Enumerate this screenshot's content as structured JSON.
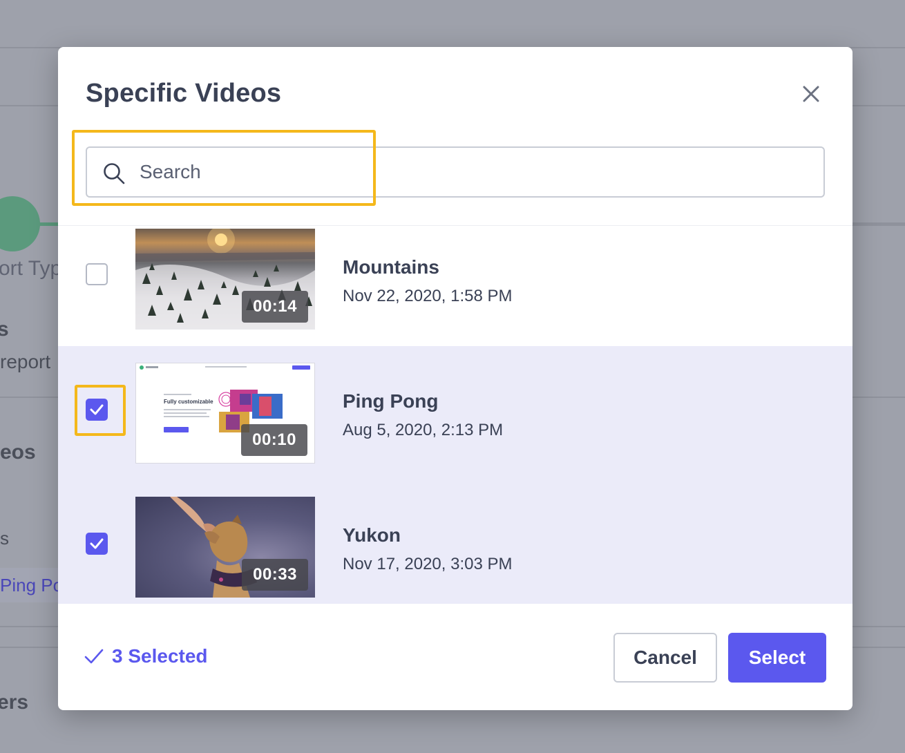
{
  "background": {
    "step_label": "ort Typ",
    "heading_s": "s",
    "report_text": "report",
    "videos_text": "eos",
    "s_text": "s",
    "chip_text": "Ping Po",
    "ers_text": "ers"
  },
  "modal": {
    "title": "Specific Videos",
    "close_icon": "close-icon"
  },
  "search": {
    "placeholder": "Search",
    "value": "",
    "icon": "search-icon"
  },
  "videos": [
    {
      "title": "Mountains",
      "date": "Nov 22, 2020, 1:58 PM",
      "duration": "00:14",
      "checked": false
    },
    {
      "title": "Ping Pong",
      "date": "Aug 5, 2020, 2:13 PM",
      "duration": "00:10",
      "checked": true
    },
    {
      "title": "Yukon",
      "date": "Nov 17, 2020, 3:03 PM",
      "duration": "00:33",
      "checked": true
    }
  ],
  "thumb_ping": {
    "heading": "Fully customizable",
    "button": "Request a demo"
  },
  "footer": {
    "selected_label": "3 Selected",
    "cancel_label": "Cancel",
    "select_label": "Select"
  },
  "colors": {
    "accent": "#5b58ee",
    "highlight": "#f4b81b",
    "selected_row": "#ebebf9"
  }
}
